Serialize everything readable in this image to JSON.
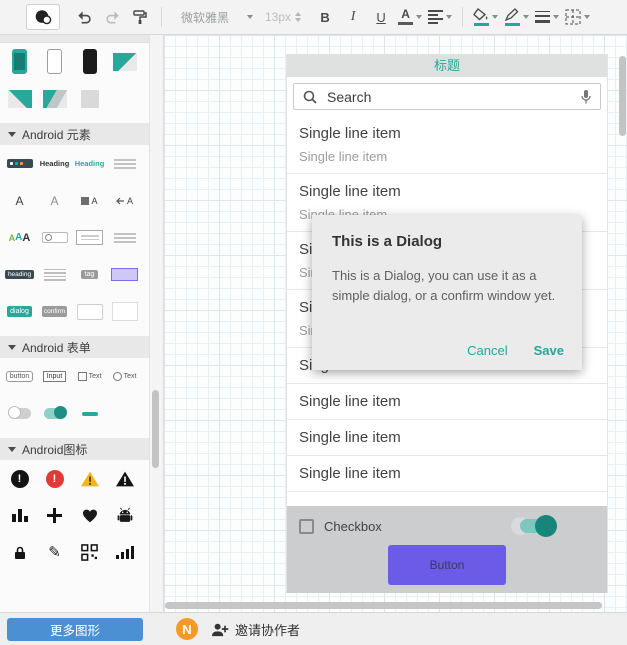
{
  "toolbar": {
    "font_family": "微软雅黑",
    "font_size": "13px",
    "bold": "B",
    "italic": "I",
    "underline": "U",
    "text_color_letter": "A"
  },
  "sidebar": {
    "sections": {
      "elements": "Android 元素",
      "forms": "Android 表单",
      "icons": "Android图标"
    },
    "thumbs": {
      "heading_bold": "Heading",
      "heading_teal": "Heading",
      "letter_a1": "A",
      "letter_a2": "A",
      "letter_a3": "A",
      "letter_a4": "A",
      "aaa": [
        "A",
        "A",
        "A"
      ],
      "heading_small": "heading",
      "tag": "tag",
      "dialog": "dialog",
      "confirm": "confirm",
      "button": "button",
      "input": "Input",
      "text_checkbox": "Text",
      "text_radio": "Text"
    },
    "more_shapes_button": "更多图形"
  },
  "canvas": {
    "mockup": {
      "header_title": "标题",
      "search_placeholder": "Search",
      "list_items": [
        {
          "title": "Single line item",
          "subtitle": "Single line item"
        },
        {
          "title": "Single line item",
          "subtitle": "Single line item"
        },
        {
          "title": "Single line item",
          "subtitle": "Single line item"
        },
        {
          "title": "Single line item",
          "subtitle": "Single line item"
        },
        {
          "title": "Single line item"
        },
        {
          "title": "Single line item"
        },
        {
          "title": "Single line item"
        },
        {
          "title": "Single line item"
        }
      ],
      "dialog": {
        "title": "This is a Dialog",
        "body": "This is a Dialog, you can use it as a simple dialog, or a confirm window yet.",
        "cancel_label": "Cancel",
        "save_label": "Save"
      },
      "checkbox_label": "Checkbox",
      "button_label": "Button"
    }
  },
  "statusbar": {
    "avatar_initial": "N",
    "invite_label": "邀请协作者"
  },
  "colors": {
    "teal": "#26a69a",
    "mockup_button": "#6b5be6",
    "more_shapes_blue": "#4a90d2",
    "avatar_orange": "#f59b25"
  }
}
